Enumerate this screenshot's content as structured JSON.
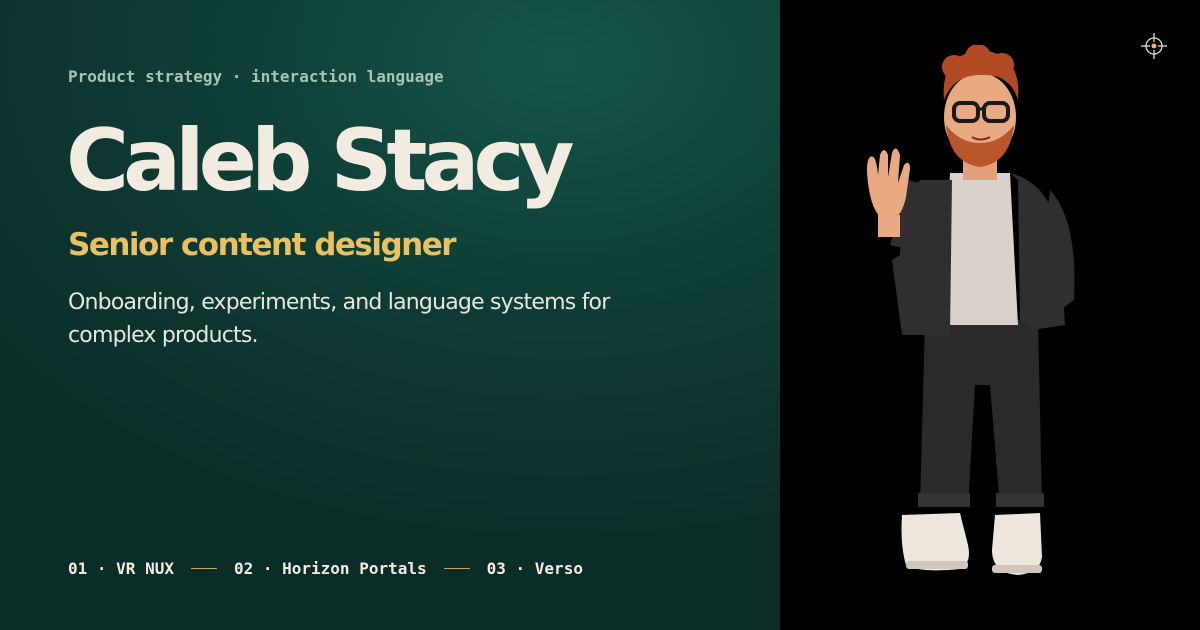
{
  "eyebrow": "Product strategy · interaction language",
  "name": "Caleb Stacy",
  "role": "Senior content designer",
  "description": "Onboarding, experiments, and language systems for complex products.",
  "projects": [
    {
      "label": "01 · VR NUX"
    },
    {
      "label": "02 · Horizon Portals"
    },
    {
      "label": "03 · Verso"
    }
  ],
  "colors": {
    "panel_green": "#0f3f37",
    "accent_gold": "#e9c063",
    "headline_cream": "#f2ece0"
  },
  "icons": {
    "corner": "crosshair-icon",
    "portrait": "avatar-waving"
  }
}
